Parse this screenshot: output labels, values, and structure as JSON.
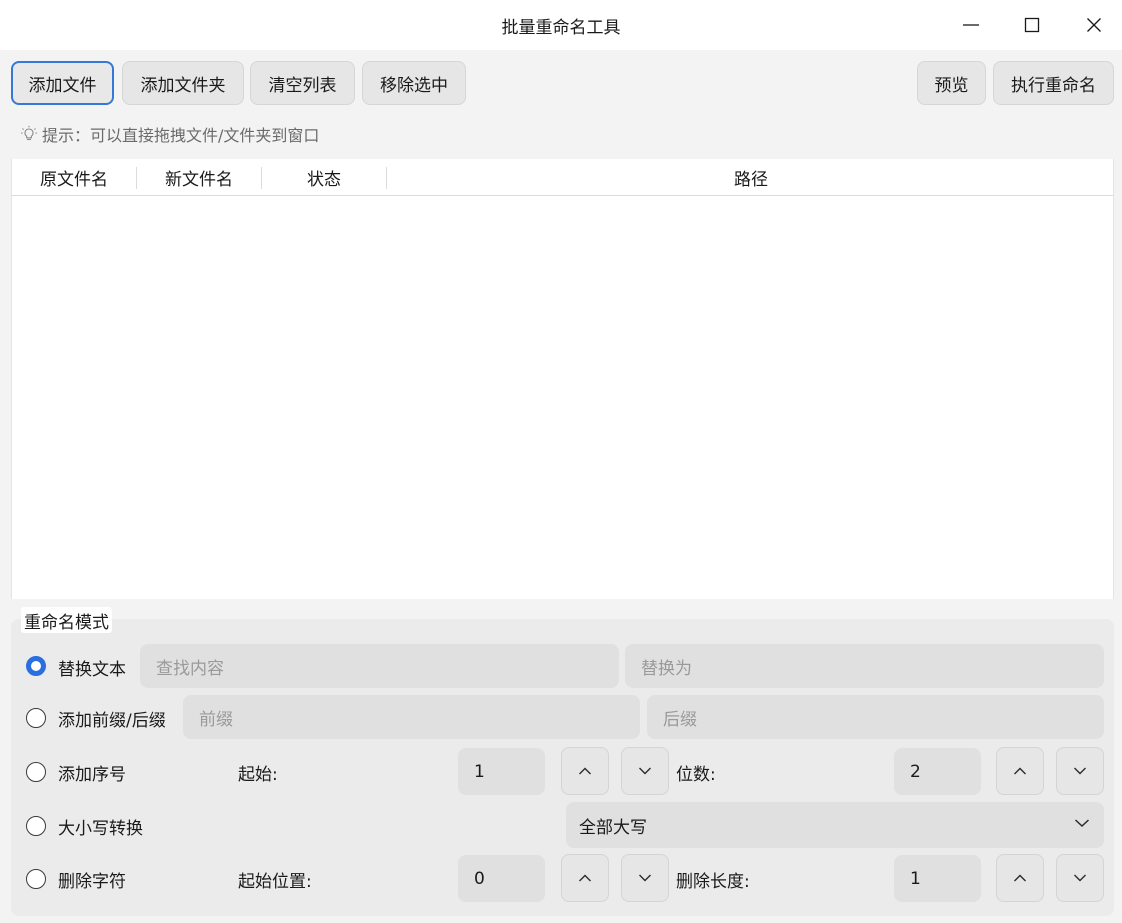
{
  "window": {
    "title": "批量重命名工具"
  },
  "toolbar": {
    "add_files": "添加文件",
    "add_folder": "添加文件夹",
    "clear_list": "清空列表",
    "remove_selected": "移除选中",
    "preview": "预览",
    "execute": "执行重命名"
  },
  "hint": {
    "text": "提示：可以直接拖拽文件/文件夹到窗口",
    "icon": "lightbulb-icon"
  },
  "table": {
    "columns": [
      "原文件名",
      "新文件名",
      "状态",
      "路径"
    ],
    "rows": []
  },
  "mode": {
    "group_title": "重命名模式",
    "selected": "替换文本",
    "replace": {
      "label": "替换文本",
      "find_placeholder": "查找内容",
      "replace_placeholder": "替换为"
    },
    "prefix_suffix": {
      "label": "添加前缀/后缀",
      "prefix_placeholder": "前缀",
      "suffix_placeholder": "后缀"
    },
    "sequence": {
      "label": "添加序号",
      "start_label": "起始:",
      "start_value": "1",
      "digits_label": "位数:",
      "digits_value": "2"
    },
    "case": {
      "label": "大小写转换",
      "selected_option": "全部大写"
    },
    "delete": {
      "label": "删除字符",
      "start_label": "起始位置:",
      "start_value": "0",
      "length_label": "删除长度:",
      "length_value": "1"
    }
  },
  "colors": {
    "accent": "#2a6fe0",
    "panel": "#ebebeb",
    "field": "#e0e0e0"
  }
}
